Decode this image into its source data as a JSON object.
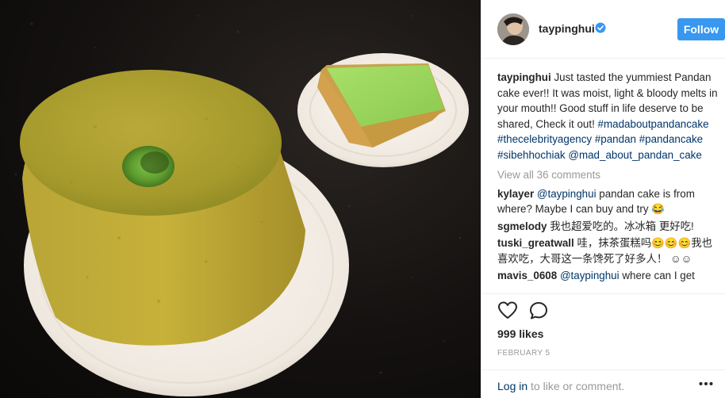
{
  "post": {
    "username": "taypinghui",
    "follow_label": "Follow",
    "caption_user": "taypinghui",
    "caption_text": "Just tasted the yummiest Pandan cake ever!! It was moist, light & bloody melts in your mouth!! Good stuff in life deserve to be shared, Check it out!",
    "hashtags": {
      "h1": "#madaboutpandancake",
      "h2": "#thecelebrityagency",
      "h3": "#pandan",
      "h4": "#pandancake",
      "h5": "#sibehhochiak",
      "h6": "@mad_about_pandan_cake"
    },
    "view_all": "View all 36 comments",
    "likes": "999 likes",
    "date": "FEBRUARY 5",
    "login_link": "Log in",
    "login_rest": " to like or comment."
  },
  "comments": [
    {
      "user": "kylayer",
      "mention": "@taypinghui",
      "text": " pandan cake is from where? Maybe I can buy and try 😂"
    },
    {
      "user": "sgmelody",
      "mention": "",
      "text": " 我也超爱吃的。冰冰箱 更好吃!"
    },
    {
      "user": "tuski_greatwall",
      "mention": "",
      "text": " 哇，抹茶蛋糕吗😊😊😊我也喜欢吃，大哥这一条馋死了好多人！ ☺☺"
    },
    {
      "user": "mavis_0608",
      "mention": "@taypinghui",
      "text": " where can I get"
    }
  ],
  "icons": {
    "verified": "verified-badge-icon",
    "heart": "heart-icon",
    "comment": "comment-bubble-icon",
    "more": "more-options-icon"
  },
  "colors": {
    "accent": "#3897f0",
    "link": "#003569",
    "muted": "#999999"
  }
}
